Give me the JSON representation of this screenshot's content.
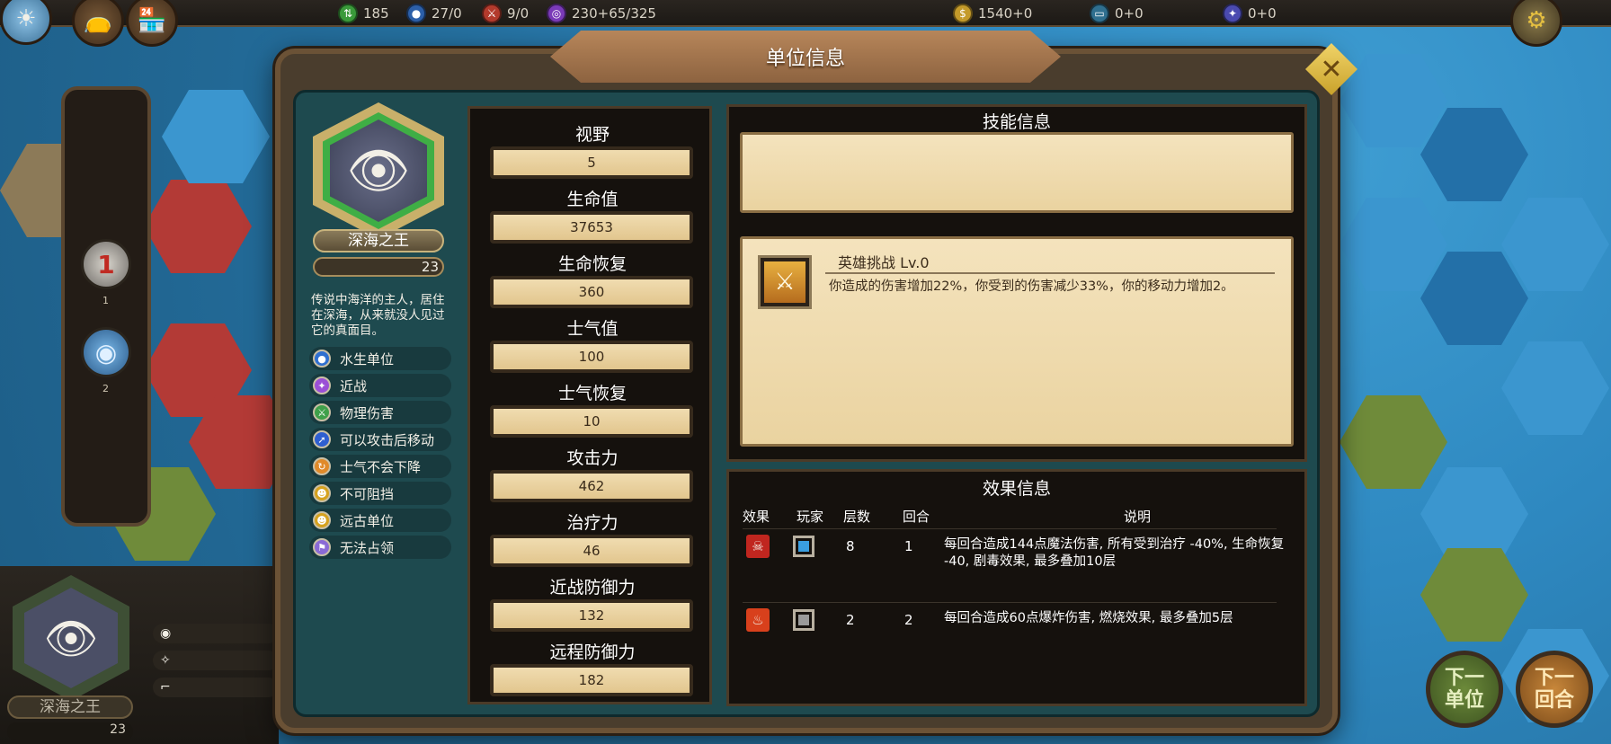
{
  "top_bar": {
    "resources": [
      {
        "icon": "food-icon",
        "value": "185",
        "color": "#3a9a3a"
      },
      {
        "icon": "population-icon",
        "value": "27/0",
        "color": "#2c5fa8"
      },
      {
        "icon": "army-icon",
        "value": "9/0",
        "color": "#b33a2c"
      },
      {
        "icon": "mana-icon",
        "value": "230+65/325",
        "color": "#7a3ab8"
      },
      {
        "icon": "gold-icon",
        "value": "1540+0",
        "color": "#c49a2a"
      },
      {
        "icon": "scroll-icon",
        "value": "0+0",
        "color": "#2f6f8f"
      },
      {
        "icon": "hammer-icon",
        "value": "0+0",
        "color": "#4a4ab0"
      }
    ]
  },
  "left_panel": {
    "slots": [
      {
        "label": "1",
        "num": "1"
      },
      {
        "label": "",
        "num": "2"
      }
    ],
    "selected_unit_name": "深海之王",
    "selected_unit_level": "23"
  },
  "action_buttons": {
    "next_unit": "下一\n单位",
    "next_turn": "下一\n回合"
  },
  "modal": {
    "title": "单位信息",
    "unit": {
      "name": "深海之王",
      "level": "23",
      "description": "传说中海洋的主人，居住在深海，从来就没人见过它的真面目。",
      "traits": [
        {
          "icon": "water-icon",
          "label": "水生单位",
          "color": "#2f6fd0"
        },
        {
          "icon": "melee-icon",
          "label": "近战",
          "color": "#9b4fd6"
        },
        {
          "icon": "physical-damage-icon",
          "label": "物理伤害",
          "color": "#3fa04a"
        },
        {
          "icon": "move-after-attack-icon",
          "label": "可以攻击后移动",
          "color": "#2f5fd0"
        },
        {
          "icon": "morale-lock-icon",
          "label": "士气不会下降",
          "color": "#e08a2a"
        },
        {
          "icon": "unstoppable-icon",
          "label": "不可阻挡",
          "color": "#d6a21f"
        },
        {
          "icon": "ancient-icon",
          "label": "远古单位",
          "color": "#d6a21f"
        },
        {
          "icon": "no-capture-icon",
          "label": "无法占领",
          "color": "#8a6ad6"
        }
      ]
    },
    "stats": [
      {
        "label": "视野",
        "value": "5"
      },
      {
        "label": "生命值",
        "value": "37653"
      },
      {
        "label": "生命恢复",
        "value": "360"
      },
      {
        "label": "士气值",
        "value": "100"
      },
      {
        "label": "士气恢复",
        "value": "10"
      },
      {
        "label": "攻击力",
        "value": "462"
      },
      {
        "label": "治疗力",
        "value": "46"
      },
      {
        "label": "近战防御力",
        "value": "132"
      },
      {
        "label": "远程防御力",
        "value": "182"
      }
    ],
    "skills": {
      "title": "技能信息",
      "items": [
        {
          "icon": "hero-challenge-icon",
          "name": "英雄挑战 Lv.0",
          "description": "你造成的伤害增加22%，你受到的伤害减少33%，你的移动力增加2。"
        }
      ]
    },
    "effects": {
      "title": "效果信息",
      "headers": {
        "effect": "效果",
        "player": "玩家",
        "stacks": "层数",
        "turns": "回合",
        "description": "说明"
      },
      "rows": [
        {
          "icon": "poison-icon",
          "icon_color": "#c0261f",
          "player_color": "#3a9ee0",
          "stacks": "8",
          "turns": "1",
          "description": "每回合造成144点魔法伤害, 所有受到治疗 -40%, 生命恢复 -40, 剧毒效果, 最多叠加10层"
        },
        {
          "icon": "burn-icon",
          "icon_color": "#d8401c",
          "player_color": "#9a9a9a",
          "stacks": "2",
          "turns": "2",
          "description": "每回合造成60点爆炸伤害, 燃烧效果, 最多叠加5层"
        }
      ]
    }
  }
}
